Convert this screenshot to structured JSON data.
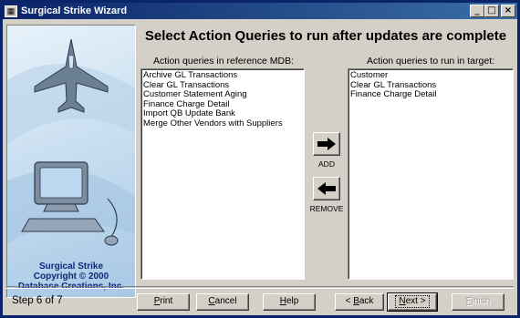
{
  "window": {
    "title": "Surgical Strike Wizard",
    "controls": {
      "minimize": "_",
      "maximize": "□",
      "close": "×"
    }
  },
  "sidebar": {
    "credits_line1": "Surgical Strike",
    "credits_line2": "Copyright © 2000",
    "credits_line3": "Database Creations, Inc.",
    "art": [
      "jet-fighter-icon",
      "computer-icon"
    ]
  },
  "heading": "Select Action Queries to run after updates are complete",
  "left_list": {
    "label": "Action queries in reference MDB:",
    "items": [
      "Archive GL Transactions",
      "Clear GL Transactions",
      "Customer Statement Aging",
      "Finance Charge Detail",
      "Import QB Update Bank",
      "Merge Other Vendors with Suppliers"
    ]
  },
  "right_list": {
    "label": "Action queries to run in target:",
    "items": [
      "Customer",
      "Clear GL Transactions",
      "Finance Charge Detail"
    ]
  },
  "transfer": {
    "add_label": "ADD",
    "remove_label": "REMOVE",
    "add_icon": "arrow-right-icon",
    "remove_icon": "arrow-left-icon"
  },
  "footer": {
    "step": "Step 6 of 7",
    "print_key": "P",
    "print_rest": "rint",
    "cancel_key": "C",
    "cancel_rest": "ancel",
    "help_key": "H",
    "help_rest": "elp",
    "back_prefix": "< ",
    "back_key": "B",
    "back_rest": "ack",
    "next_key": "N",
    "next_rest": "ext >",
    "finish_key": "F",
    "finish_rest": "inish"
  },
  "colors": {
    "face": "#d4d0c8",
    "title_bar": "#0a246a",
    "credits_text": "#0a2a7a"
  }
}
